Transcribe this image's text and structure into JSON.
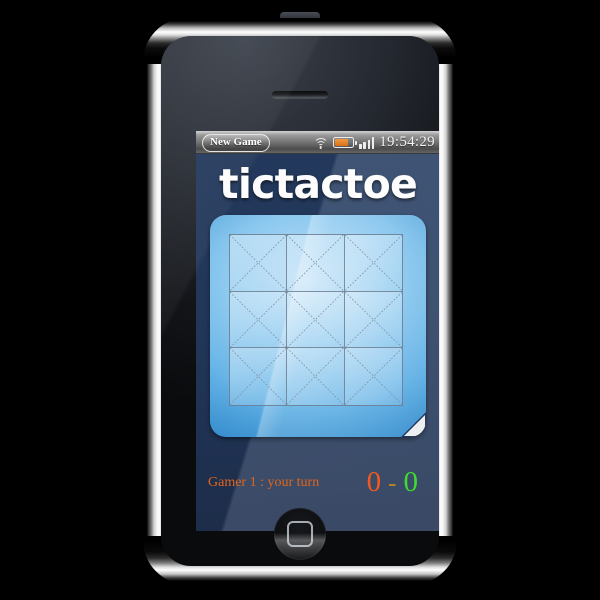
{
  "app": {
    "title": "tictactoe"
  },
  "status_bar": {
    "new_game_label": "New Game",
    "wifi_icon": "wifi-icon",
    "battery_icon": "battery-icon",
    "battery_level_percent": 74,
    "signal_icon": "signal-bars-icon",
    "signal_bars": 4,
    "clock": "19:54:29"
  },
  "board": {
    "rows": 3,
    "cols": 3,
    "cells": [
      {
        "index": 0,
        "mark": "",
        "state": "empty"
      },
      {
        "index": 1,
        "mark": "",
        "state": "empty"
      },
      {
        "index": 2,
        "mark": "",
        "state": "empty"
      },
      {
        "index": 3,
        "mark": "",
        "state": "empty"
      },
      {
        "index": 4,
        "mark": "",
        "state": "empty"
      },
      {
        "index": 5,
        "mark": "",
        "state": "empty"
      },
      {
        "index": 6,
        "mark": "",
        "state": "empty"
      },
      {
        "index": 7,
        "mark": "",
        "state": "empty"
      },
      {
        "index": 8,
        "mark": "",
        "state": "empty"
      }
    ],
    "page_curl_icon": "page-curl-icon"
  },
  "footer": {
    "turn_text": "Gamer 1 : your turn",
    "score": {
      "player1": "0",
      "separator": "-",
      "player2": "0"
    }
  },
  "device": {
    "earpiece_icon": "earpiece-speaker-icon",
    "home_button_icon": "home-button-icon",
    "power_button_icon": "power-button-icon"
  },
  "colors": {
    "screen_bg": "#22375a",
    "panel_blue": "#5aade4",
    "turn_orange": "#e1651c",
    "score_p1": "#f2591f",
    "score_dash": "#b8861f",
    "score_p2": "#3ddc2e",
    "battery_fill": "#e0801f",
    "title_white": "#fdfdfd"
  }
}
